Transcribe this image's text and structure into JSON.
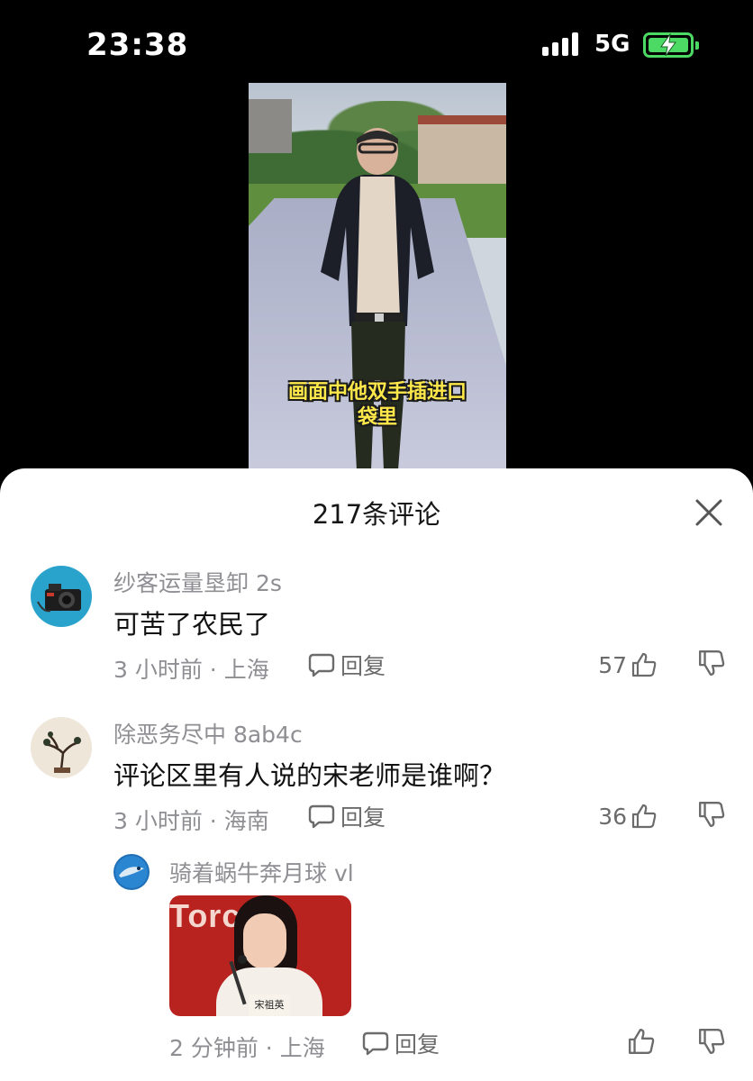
{
  "status_bar": {
    "time": "23:38",
    "network": "5G",
    "colors": {
      "battery": "#4cd964"
    },
    "icons": [
      "signal-icon",
      "battery-charging-icon"
    ]
  },
  "video": {
    "caption_line1": "画面中他双手插进口",
    "caption_line2": "袋里",
    "caption_color": "#ffe94a"
  },
  "comments_panel": {
    "title": "217条评论",
    "close_icon": "close-icon",
    "comments": [
      {
        "username": "纱客运量垦卸 2s",
        "content": "可苦了农民了",
        "meta": "3 小时前 · 上海",
        "reply_label": "回复",
        "like_count": "57"
      },
      {
        "username": "除恶务尽中 8ab4c",
        "content": "评论区里有人说的宋老师是谁啊？",
        "meta": "3 小时前 · 海南",
        "reply_label": "回复",
        "like_count": "36",
        "reply": {
          "username": "骑着蜗牛奔月球 vl",
          "image_text": "Torc Re",
          "image_namecard": "宋祖英",
          "meta": "2 分钟前 · 上海",
          "reply_label": "回复"
        }
      }
    ]
  }
}
